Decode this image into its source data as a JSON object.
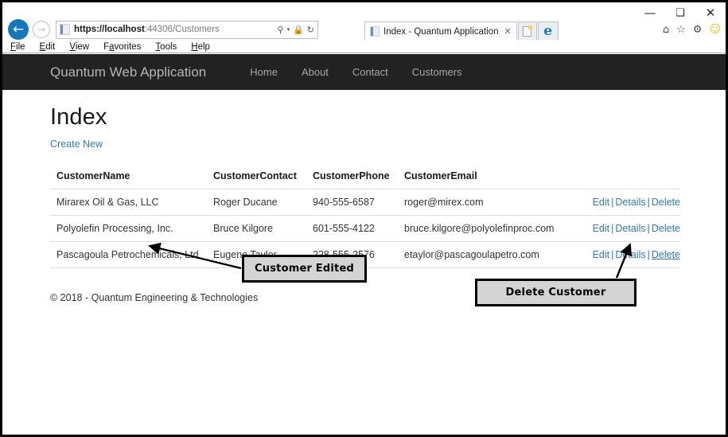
{
  "browser": {
    "window_controls": {
      "minimize": "—",
      "maximize": "❑",
      "close": "✕"
    },
    "nav": {
      "back_icon": "←",
      "forward_icon": "→"
    },
    "address": {
      "url_host": "https://localhost",
      "url_rest": ":44306/Customers",
      "search_icon": "⚲",
      "caret_icon": "▾",
      "lock_icon": "🔒",
      "refresh_icon": "↻"
    },
    "tab": {
      "title": "Index - Quantum Application",
      "close_icon": "✕"
    },
    "new_tab_label": "",
    "e_logo": "e",
    "tool_icons": {
      "home": "⌂",
      "favorites": "☆",
      "settings": "⚙",
      "smiley": "☺"
    },
    "menus": [
      {
        "accel": "F",
        "rest": "ile"
      },
      {
        "accel": "E",
        "rest": "dit"
      },
      {
        "accel": "V",
        "rest": "iew"
      },
      {
        "accel": "F",
        "pre": "Fa",
        "rest": "vorites"
      },
      {
        "accel": "T",
        "rest": "ools"
      },
      {
        "accel": "H",
        "rest": "elp"
      }
    ],
    "menu_labels": [
      "File",
      "Edit",
      "View",
      "Favorites",
      "Tools",
      "Help"
    ]
  },
  "site": {
    "brand": "Quantum Web Application",
    "nav_links": [
      "Home",
      "About",
      "Contact",
      "Customers"
    ],
    "page_title": "Index",
    "create_new_label": "Create New",
    "footer": "© 2018 - Quantum Engineering & Technologies",
    "navbar_color": "#222222",
    "link_color": "#337ab7"
  },
  "table": {
    "headers": [
      "CustomerName",
      "CustomerContact",
      "CustomerPhone",
      "CustomerEmail"
    ],
    "actions": {
      "edit": "Edit",
      "details": "Details",
      "delete": "Delete",
      "separator": "|"
    },
    "rows": [
      {
        "name": "Mirarex Oil & Gas, LLC",
        "contact": "Roger Ducane",
        "phone": "940-555-6587",
        "email": "roger@mirex.com"
      },
      {
        "name": "Polyolefin Processing, Inc.",
        "contact": "Bruce Kilgore",
        "phone": "601-555-4122",
        "email": "bruce.kilgore@polyolefinproc.com"
      },
      {
        "name": "Pascagoula Petrochemicals, Ltd",
        "contact": "Eugene Taylor",
        "phone": "228-555-2576",
        "email": "etaylor@pascagoulapetro.com"
      }
    ]
  },
  "annotations": [
    {
      "label": "Customer Edited",
      "fill": "#d4d4d4",
      "border": "#000000"
    },
    {
      "label": "Delete Customer",
      "fill": "#d4d4d4",
      "border": "#000000"
    }
  ]
}
